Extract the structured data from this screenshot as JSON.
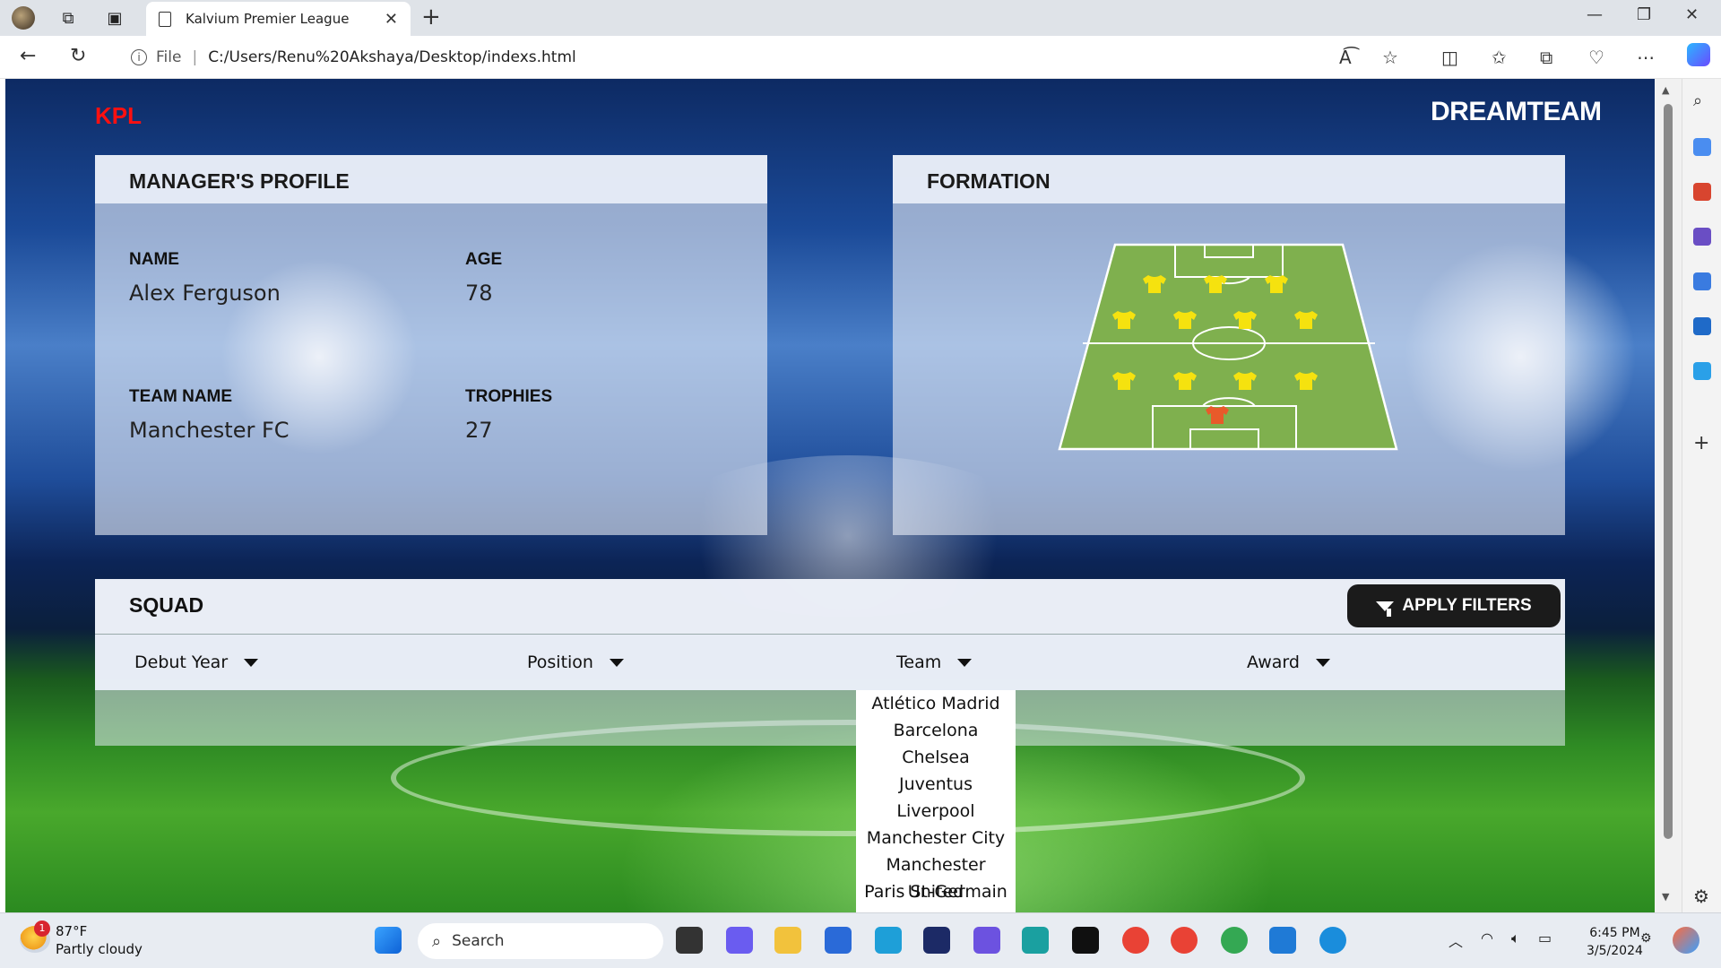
{
  "browser": {
    "tab_title": "Kalvium Premier League",
    "url_prefix": "File",
    "url": "C:/Users/Renu%20Akshaya/Desktop/indexs.html"
  },
  "header": {
    "logo": "KPL",
    "brand": "DREAMTEAM"
  },
  "profile": {
    "title": "MANAGER'S PROFILE",
    "name_label": "NAME",
    "name": "Alex Ferguson",
    "age_label": "AGE",
    "age": "78",
    "team_label": "TEAM NAME",
    "team": "Manchester FC",
    "trophies_label": "TROPHIES",
    "trophies": "27"
  },
  "formation": {
    "title": "FORMATION",
    "pitch_color": "#7fb04e",
    "player_color": "#f5e20f",
    "keeper_color": "#e85a2a"
  },
  "squad": {
    "title": "SQUAD",
    "apply_label": "APPLY FILTERS",
    "filters": [
      "Debut Year",
      "Position",
      "Team",
      "Award"
    ]
  },
  "team_dropdown": {
    "options": [
      "Atlético Madrid",
      "Barcelona",
      "Chelsea",
      "Juventus",
      "Liverpool",
      "Manchester City",
      "Manchester United",
      "Paris St-Germain"
    ]
  },
  "taskbar": {
    "search_placeholder": "Search",
    "weather_temp": "87°F",
    "weather_desc": "Partly cloudy",
    "weather_badge": "1",
    "time": "6:45 PM",
    "date": "3/5/2024"
  }
}
